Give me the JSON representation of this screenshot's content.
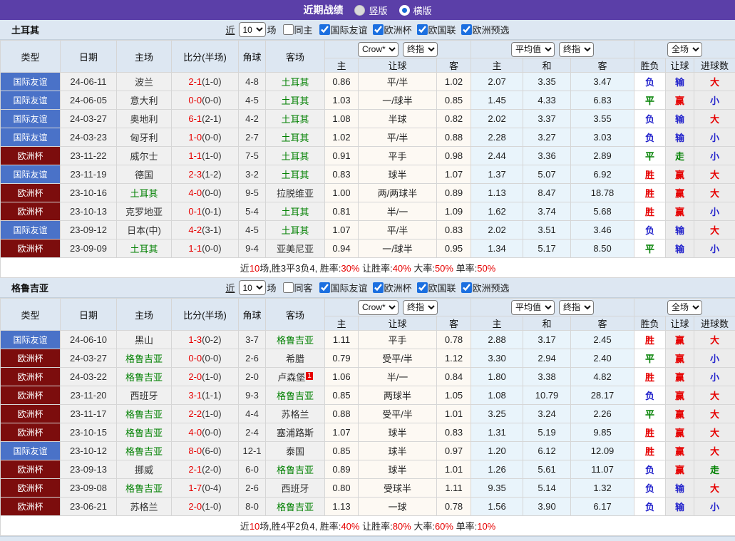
{
  "title_bar": {
    "title": "近期战绩",
    "vertical_label": "竖版",
    "horizontal_label": "横版"
  },
  "filter": {
    "near": "近",
    "count": "10",
    "games": "场",
    "leagues": [
      "国际友谊",
      "欧洲杯",
      "欧国联",
      "欧洲预选"
    ]
  },
  "dropdowns": {
    "bookmaker": "Crow*",
    "final_ah": "终指",
    "average": "平均值",
    "final_eu": "终指",
    "full_match": "全场"
  },
  "columns": {
    "type": "类型",
    "date": "日期",
    "home": "主场",
    "score": "比分(半场)",
    "corner": "角球",
    "away": "客场",
    "ah_home": "主",
    "handicap": "让球",
    "ah_away": "客",
    "eu_home": "主",
    "eu_draw": "和",
    "eu_away": "客",
    "wdl": "胜负",
    "hcp_result": "让球",
    "goals": "进球数"
  },
  "colors": {
    "accent": "#5b3fa8",
    "type": {
      "国际友谊": "#4a72c8",
      "欧洲杯": "#7c0d0d"
    },
    "team_name": "#008000",
    "score": "#e60000",
    "value": {
      "胜": "#e60000",
      "赢": "#e60000",
      "大": "#e60000",
      "平": "#008000",
      "走": "#008000",
      "负": "#2424cc",
      "输": "#2424cc",
      "小": "#2424cc"
    }
  },
  "sections": [
    {
      "team": "土耳其",
      "same_label": "同主",
      "rows": [
        {
          "type": "国际友谊",
          "date": "24-06-11",
          "home": "波兰",
          "homeTeam": false,
          "ft": "2-1",
          "ht": "(1-0)",
          "corner": "4-8",
          "away": "土耳其",
          "awayTeam": true,
          "awayBadge": null,
          "ah": [
            "0.86",
            "平/半",
            "1.02"
          ],
          "eu": [
            "2.07",
            "3.35",
            "3.47"
          ],
          "res": [
            "负",
            "输",
            "大"
          ]
        },
        {
          "type": "国际友谊",
          "date": "24-06-05",
          "home": "意大利",
          "homeTeam": false,
          "ft": "0-0",
          "ht": "(0-0)",
          "corner": "4-5",
          "away": "土耳其",
          "awayTeam": true,
          "awayBadge": null,
          "ah": [
            "1.03",
            "一/球半",
            "0.85"
          ],
          "eu": [
            "1.45",
            "4.33",
            "6.83"
          ],
          "res": [
            "平",
            "赢",
            "小"
          ]
        },
        {
          "type": "国际友谊",
          "date": "24-03-27",
          "home": "奥地利",
          "homeTeam": false,
          "ft": "6-1",
          "ht": "(2-1)",
          "corner": "4-2",
          "away": "土耳其",
          "awayTeam": true,
          "awayBadge": null,
          "ah": [
            "1.08",
            "半球",
            "0.82"
          ],
          "eu": [
            "2.02",
            "3.37",
            "3.55"
          ],
          "res": [
            "负",
            "输",
            "大"
          ]
        },
        {
          "type": "国际友谊",
          "date": "24-03-23",
          "home": "匈牙利",
          "homeTeam": false,
          "ft": "1-0",
          "ht": "(0-0)",
          "corner": "2-7",
          "away": "土耳其",
          "awayTeam": true,
          "awayBadge": null,
          "ah": [
            "1.02",
            "平/半",
            "0.88"
          ],
          "eu": [
            "2.28",
            "3.27",
            "3.03"
          ],
          "res": [
            "负",
            "输",
            "小"
          ]
        },
        {
          "type": "欧洲杯",
          "date": "23-11-22",
          "home": "威尔士",
          "homeTeam": false,
          "ft": "1-1",
          "ht": "(1-0)",
          "corner": "7-5",
          "away": "土耳其",
          "awayTeam": true,
          "awayBadge": null,
          "ah": [
            "0.91",
            "平手",
            "0.98"
          ],
          "eu": [
            "2.44",
            "3.36",
            "2.89"
          ],
          "res": [
            "平",
            "走",
            "小"
          ]
        },
        {
          "type": "国际友谊",
          "date": "23-11-19",
          "home": "德国",
          "homeTeam": false,
          "ft": "2-3",
          "ht": "(1-2)",
          "corner": "3-2",
          "away": "土耳其",
          "awayTeam": true,
          "awayBadge": null,
          "ah": [
            "0.83",
            "球半",
            "1.07"
          ],
          "eu": [
            "1.37",
            "5.07",
            "6.92"
          ],
          "res": [
            "胜",
            "赢",
            "大"
          ]
        },
        {
          "type": "欧洲杯",
          "date": "23-10-16",
          "home": "土耳其",
          "homeTeam": true,
          "ft": "4-0",
          "ht": "(0-0)",
          "corner": "9-5",
          "away": "拉脱维亚",
          "awayTeam": false,
          "awayBadge": null,
          "ah": [
            "1.00",
            "两/两球半",
            "0.89"
          ],
          "eu": [
            "1.13",
            "8.47",
            "18.78"
          ],
          "res": [
            "胜",
            "赢",
            "大"
          ]
        },
        {
          "type": "欧洲杯",
          "date": "23-10-13",
          "home": "克罗地亚",
          "homeTeam": false,
          "ft": "0-1",
          "ht": "(0-1)",
          "corner": "5-4",
          "away": "土耳其",
          "awayTeam": true,
          "awayBadge": null,
          "ah": [
            "0.81",
            "半/一",
            "1.09"
          ],
          "eu": [
            "1.62",
            "3.74",
            "5.68"
          ],
          "res": [
            "胜",
            "赢",
            "小"
          ]
        },
        {
          "type": "国际友谊",
          "date": "23-09-12",
          "home": "日本(中)",
          "homeTeam": false,
          "ft": "4-2",
          "ht": "(3-1)",
          "corner": "4-5",
          "away": "土耳其",
          "awayTeam": true,
          "awayBadge": null,
          "ah": [
            "1.07",
            "平/半",
            "0.83"
          ],
          "eu": [
            "2.02",
            "3.51",
            "3.46"
          ],
          "res": [
            "负",
            "输",
            "大"
          ]
        },
        {
          "type": "欧洲杯",
          "date": "23-09-09",
          "home": "土耳其",
          "homeTeam": true,
          "ft": "1-1",
          "ht": "(0-0)",
          "corner": "9-4",
          "away": "亚美尼亚",
          "awayTeam": false,
          "awayBadge": null,
          "ah": [
            "0.94",
            "一/球半",
            "0.95"
          ],
          "eu": [
            "1.34",
            "5.17",
            "8.50"
          ],
          "res": [
            "平",
            "输",
            "小"
          ]
        }
      ],
      "summary": [
        {
          "t": "近"
        },
        {
          "t": "10",
          "r": 1
        },
        {
          "t": "场,胜3平3负4, 胜率:"
        },
        {
          "t": "30%",
          "r": 1
        },
        {
          "t": " 让胜率:"
        },
        {
          "t": "40%",
          "r": 1
        },
        {
          "t": " 大率:"
        },
        {
          "t": "50%",
          "r": 1
        },
        {
          "t": " 单率:"
        },
        {
          "t": "50%",
          "r": 1
        }
      ]
    },
    {
      "team": "格鲁吉亚",
      "same_label": "同客",
      "rows": [
        {
          "type": "国际友谊",
          "date": "24-06-10",
          "home": "黑山",
          "homeTeam": false,
          "ft": "1-3",
          "ht": "(0-2)",
          "corner": "3-7",
          "away": "格鲁吉亚",
          "awayTeam": true,
          "awayBadge": null,
          "ah": [
            "1.11",
            "平手",
            "0.78"
          ],
          "eu": [
            "2.88",
            "3.17",
            "2.45"
          ],
          "res": [
            "胜",
            "赢",
            "大"
          ]
        },
        {
          "type": "欧洲杯",
          "date": "24-03-27",
          "home": "格鲁吉亚",
          "homeTeam": true,
          "ft": "0-0",
          "ht": "(0-0)",
          "corner": "2-6",
          "away": "希腊",
          "awayTeam": false,
          "awayBadge": null,
          "ah": [
            "0.79",
            "受平/半",
            "1.12"
          ],
          "eu": [
            "3.30",
            "2.94",
            "2.40"
          ],
          "res": [
            "平",
            "赢",
            "小"
          ]
        },
        {
          "type": "欧洲杯",
          "date": "24-03-22",
          "home": "格鲁吉亚",
          "homeTeam": true,
          "ft": "2-0",
          "ht": "(1-0)",
          "corner": "2-0",
          "away": "卢森堡",
          "awayTeam": false,
          "awayBadge": "1",
          "ah": [
            "1.06",
            "半/一",
            "0.84"
          ],
          "eu": [
            "1.80",
            "3.38",
            "4.82"
          ],
          "res": [
            "胜",
            "赢",
            "小"
          ]
        },
        {
          "type": "欧洲杯",
          "date": "23-11-20",
          "home": "西班牙",
          "homeTeam": false,
          "ft": "3-1",
          "ht": "(1-1)",
          "corner": "9-3",
          "away": "格鲁吉亚",
          "awayTeam": true,
          "awayBadge": null,
          "ah": [
            "0.85",
            "两球半",
            "1.05"
          ],
          "eu": [
            "1.08",
            "10.79",
            "28.17"
          ],
          "res": [
            "负",
            "赢",
            "大"
          ]
        },
        {
          "type": "欧洲杯",
          "date": "23-11-17",
          "home": "格鲁吉亚",
          "homeTeam": true,
          "ft": "2-2",
          "ht": "(1-0)",
          "corner": "4-4",
          "away": "苏格兰",
          "awayTeam": false,
          "awayBadge": null,
          "ah": [
            "0.88",
            "受平/半",
            "1.01"
          ],
          "eu": [
            "3.25",
            "3.24",
            "2.26"
          ],
          "res": [
            "平",
            "赢",
            "大"
          ]
        },
        {
          "type": "欧洲杯",
          "date": "23-10-15",
          "home": "格鲁吉亚",
          "homeTeam": true,
          "ft": "4-0",
          "ht": "(0-0)",
          "corner": "2-4",
          "away": "塞浦路斯",
          "awayTeam": false,
          "awayBadge": null,
          "ah": [
            "1.07",
            "球半",
            "0.83"
          ],
          "eu": [
            "1.31",
            "5.19",
            "9.85"
          ],
          "res": [
            "胜",
            "赢",
            "大"
          ]
        },
        {
          "type": "国际友谊",
          "date": "23-10-12",
          "home": "格鲁吉亚",
          "homeTeam": true,
          "ft": "8-0",
          "ht": "(6-0)",
          "corner": "12-1",
          "away": "泰国",
          "awayTeam": false,
          "awayBadge": null,
          "ah": [
            "0.85",
            "球半",
            "0.97"
          ],
          "eu": [
            "1.20",
            "6.12",
            "12.09"
          ],
          "res": [
            "胜",
            "赢",
            "大"
          ]
        },
        {
          "type": "欧洲杯",
          "date": "23-09-13",
          "home": "挪威",
          "homeTeam": false,
          "ft": "2-1",
          "ht": "(2-0)",
          "corner": "6-0",
          "away": "格鲁吉亚",
          "awayTeam": true,
          "awayBadge": null,
          "ah": [
            "0.89",
            "球半",
            "1.01"
          ],
          "eu": [
            "1.26",
            "5.61",
            "11.07"
          ],
          "res": [
            "负",
            "赢",
            "走"
          ]
        },
        {
          "type": "欧洲杯",
          "date": "23-09-08",
          "home": "格鲁吉亚",
          "homeTeam": true,
          "ft": "1-7",
          "ht": "(0-4)",
          "corner": "2-6",
          "away": "西班牙",
          "awayTeam": false,
          "awayBadge": null,
          "ah": [
            "0.80",
            "受球半",
            "1.11"
          ],
          "eu": [
            "9.35",
            "5.14",
            "1.32"
          ],
          "res": [
            "负",
            "输",
            "大"
          ]
        },
        {
          "type": "欧洲杯",
          "date": "23-06-21",
          "home": "苏格兰",
          "homeTeam": false,
          "ft": "2-0",
          "ht": "(1-0)",
          "corner": "8-0",
          "away": "格鲁吉亚",
          "awayTeam": true,
          "awayBadge": null,
          "ah": [
            "1.13",
            "一球",
            "0.78"
          ],
          "eu": [
            "1.56",
            "3.90",
            "6.17"
          ],
          "res": [
            "负",
            "输",
            "小"
          ]
        }
      ],
      "summary": [
        {
          "t": "近"
        },
        {
          "t": "10",
          "r": 1
        },
        {
          "t": "场,胜4平2负4, 胜率:"
        },
        {
          "t": "40%",
          "r": 1
        },
        {
          "t": " 让胜率:"
        },
        {
          "t": "80%",
          "r": 1
        },
        {
          "t": " 大率:"
        },
        {
          "t": "60%",
          "r": 1
        },
        {
          "t": " 单率:"
        },
        {
          "t": "10%",
          "r": 1
        }
      ]
    }
  ]
}
